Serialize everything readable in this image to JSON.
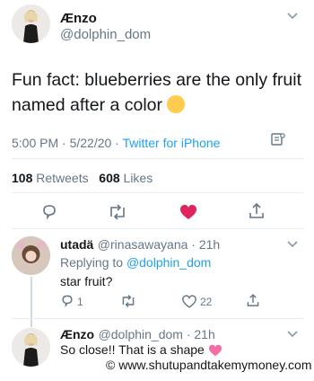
{
  "main_tweet": {
    "name": "Ænzo",
    "handle": "@dolphin_dom",
    "text": "Fun fact: blueberries are the only fruit named after a color",
    "time": "5:00 PM · 5/22/20 · ",
    "source": "Twitter for iPhone",
    "retweets_count": "108",
    "retweets_label": "Retweets",
    "likes_count": "608",
    "likes_label": "Likes"
  },
  "reply1": {
    "name": "utadä",
    "handle_time": "@rinasawayana · 21h",
    "replying_prefix": "Replying to ",
    "replying_handle": "@dolphin_dom",
    "text": "star fruit?",
    "reply_count": "1",
    "like_count": "22"
  },
  "reply2": {
    "name": "Ænzo",
    "handle_time": "@dolphin_dom · 21h",
    "text": "So close!! That is a shape"
  },
  "watermark": "© www.shutupandtakemymoney.com",
  "colors": {
    "accent": "#1da1f2",
    "like": "#e0245e",
    "muted": "#657786"
  }
}
